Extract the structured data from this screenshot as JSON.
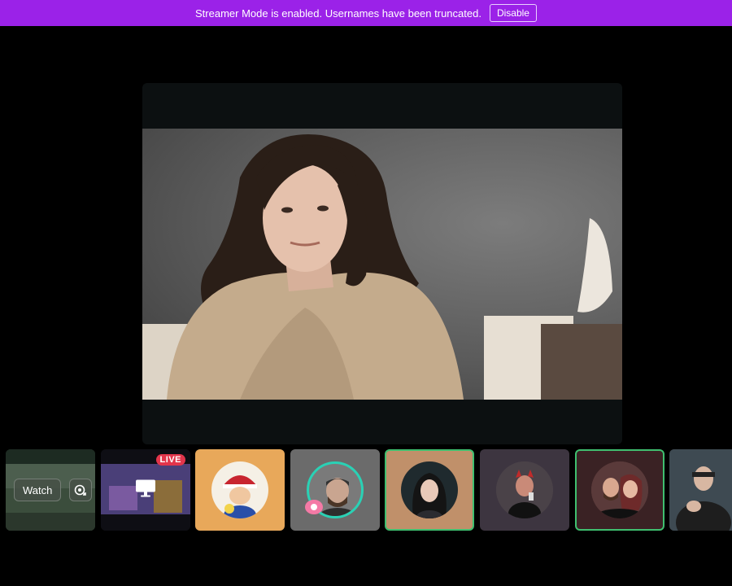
{
  "banner": {
    "message": "Streamer Mode is enabled. Usernames have been truncated.",
    "disable_label": "Disable",
    "color": "#9b22e8"
  },
  "stage": {
    "icon": "person-video-feed"
  },
  "tiles": {
    "watch_label": "Watch",
    "watch_icon": "picture-in-picture-icon",
    "live_label": "LIVE",
    "live_icon": "screen-share-icon",
    "speaking_color": "#3fbf6f"
  }
}
